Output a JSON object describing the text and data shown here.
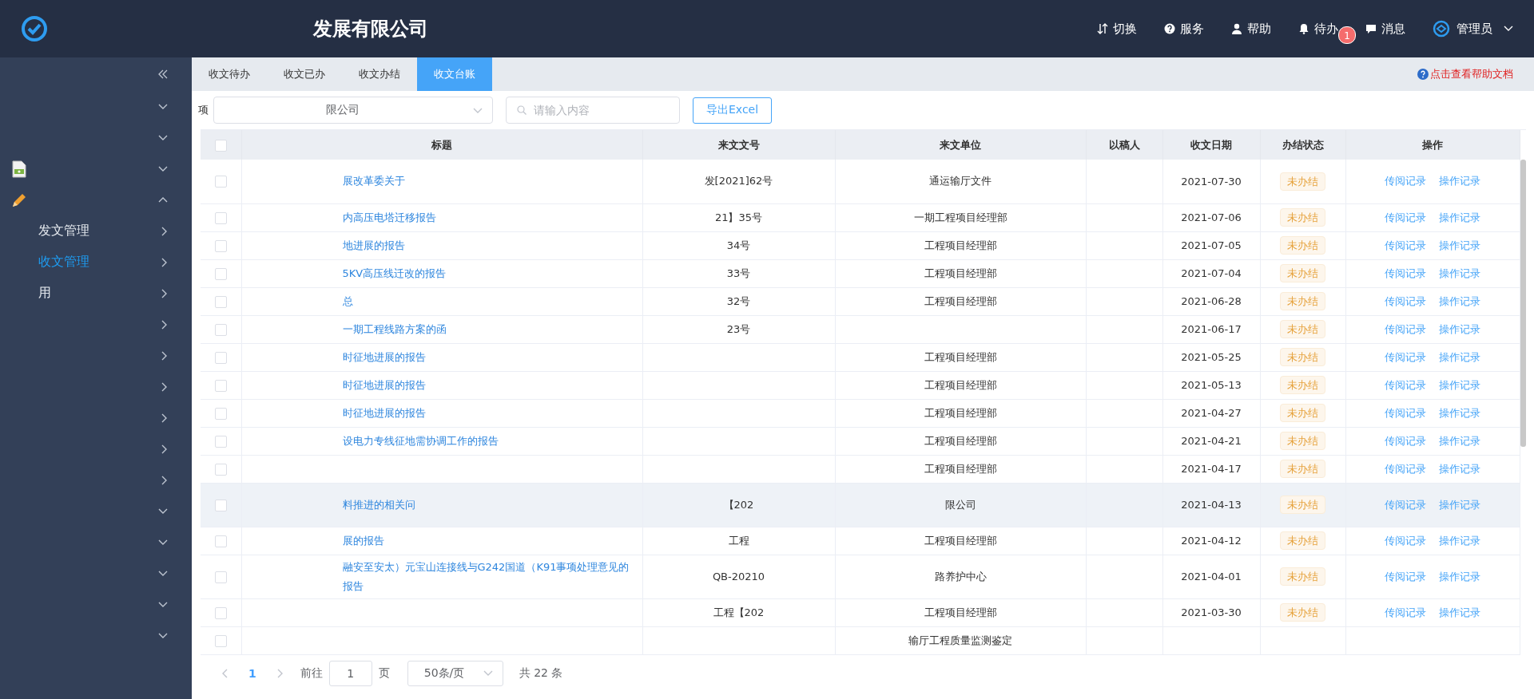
{
  "header": {
    "title": "发展有限公司",
    "actions": [
      {
        "kind": "switch",
        "label": "切换"
      },
      {
        "kind": "service",
        "label": "服务"
      },
      {
        "kind": "help",
        "label": "帮助"
      },
      {
        "kind": "todo",
        "label": "待办",
        "badge": "1"
      },
      {
        "kind": "message",
        "label": "消息"
      }
    ],
    "user": {
      "label": "管理员"
    }
  },
  "sidebar": {
    "items": [
      {
        "kind": "group",
        "expanded": false
      },
      {
        "kind": "group",
        "expanded": false
      },
      {
        "kind": "doc-group",
        "expanded": false
      },
      {
        "kind": "pencil-group",
        "expanded": true
      },
      {
        "kind": "sub",
        "label": "发文管理",
        "selected": false
      },
      {
        "kind": "sub",
        "label": "收文管理",
        "selected": true
      },
      {
        "kind": "sub",
        "label": "用",
        "selected": false
      },
      {
        "kind": "sub"
      },
      {
        "kind": "sub"
      },
      {
        "kind": "sub"
      },
      {
        "kind": "sub"
      },
      {
        "kind": "sub"
      },
      {
        "kind": "sub"
      },
      {
        "kind": "group",
        "expanded": false
      },
      {
        "kind": "group",
        "expanded": false
      },
      {
        "kind": "group",
        "expanded": false
      },
      {
        "kind": "group",
        "expanded": false
      },
      {
        "kind": "group",
        "expanded": false
      }
    ]
  },
  "tabs": [
    {
      "label": "收文待办",
      "selected": false
    },
    {
      "label": "收文已办",
      "selected": false
    },
    {
      "label": "收文办结",
      "selected": false
    },
    {
      "label": "收文台账",
      "selected": true
    }
  ],
  "help_link": "点击查看帮助文档",
  "filters": {
    "label": "项",
    "select_value": "限公司",
    "search": {
      "placeholder": "请输入内容"
    },
    "export_button": "导出Excel"
  },
  "table": {
    "all_selected": false,
    "columns": [
      "标题",
      "来文文号",
      "来文单位",
      "以稿人",
      "收文日期",
      "办结状态",
      "操作"
    ],
    "rows": [
      {
        "title": "展改革委关于",
        "doc_no": "发[2021]62号",
        "unit": "通运输厅文件",
        "date": "2021-07-30",
        "status": {
          "label": "未办结",
          "kind": "open"
        },
        "actions": [
          "传阅记录",
          "操作记录"
        ],
        "tall": true,
        "hovered": false
      },
      {
        "title": "内高压电塔迁移报告",
        "doc_no": "21】35号",
        "unit": "一期工程项目经理部",
        "date": "2021-07-06",
        "status": {
          "label": "未办结",
          "kind": "open"
        },
        "actions": [
          "传阅记录",
          "操作记录"
        ],
        "tall": false,
        "hovered": false
      },
      {
        "title": "地进展的报告",
        "doc_no": "34号",
        "unit": "工程项目经理部",
        "date": "2021-07-05",
        "status": {
          "label": "未办结",
          "kind": "open"
        },
        "actions": [
          "传阅记录",
          "操作记录"
        ],
        "tall": false,
        "hovered": false
      },
      {
        "title": "5KV高压线迁改的报告",
        "doc_no": "33号",
        "unit": "工程项目经理部",
        "date": "2021-07-04",
        "status": {
          "label": "未办结",
          "kind": "open"
        },
        "actions": [
          "传阅记录",
          "操作记录"
        ],
        "tall": false,
        "hovered": false
      },
      {
        "title": "总",
        "doc_no": "32号",
        "unit": "工程项目经理部",
        "date": "2021-06-28",
        "status": {
          "label": "未办结",
          "kind": "open"
        },
        "actions": [
          "传阅记录",
          "操作记录"
        ],
        "tall": false,
        "hovered": false
      },
      {
        "title": "一期工程线路方案的函",
        "doc_no": "23号",
        "date": "2021-06-17",
        "status": {
          "label": "未办结",
          "kind": "open"
        },
        "actions": [
          "传阅记录",
          "操作记录"
        ],
        "tall": false,
        "hovered": false
      },
      {
        "title": "时征地进展的报告",
        "unit": "工程项目经理部",
        "date": "2021-05-25",
        "status": {
          "label": "未办结",
          "kind": "open"
        },
        "actions": [
          "传阅记录",
          "操作记录"
        ],
        "tall": false,
        "hovered": false
      },
      {
        "title": "时征地进展的报告",
        "unit": "工程项目经理部",
        "date": "2021-05-13",
        "status": {
          "label": "未办结",
          "kind": "open"
        },
        "actions": [
          "传阅记录",
          "操作记录"
        ],
        "tall": false,
        "hovered": false
      },
      {
        "title": "时征地进展的报告",
        "unit": "工程项目经理部",
        "date": "2021-04-27",
        "status": {
          "label": "未办结",
          "kind": "open"
        },
        "actions": [
          "传阅记录",
          "操作记录"
        ],
        "tall": false,
        "hovered": false
      },
      {
        "title": "设电力专线征地需协调工作的报告",
        "unit": "工程项目经理部",
        "date": "2021-04-21",
        "status": {
          "label": "未办结",
          "kind": "open"
        },
        "actions": [
          "传阅记录",
          "操作记录"
        ],
        "tall": false,
        "hovered": false
      },
      {
        "unit": "工程项目经理部",
        "date": "2021-04-17",
        "status": {
          "label": "未办结",
          "kind": "open"
        },
        "actions": [
          "传阅记录",
          "操作记录"
        ],
        "tall": false,
        "hovered": false
      },
      {
        "title": "料推进的相关问",
        "doc_no": "【202",
        "unit": "限公司",
        "date": "2021-04-13",
        "status": {
          "label": "未办结",
          "kind": "open"
        },
        "actions": [
          "传阅记录",
          "操作记录"
        ],
        "tall": true,
        "hovered": true
      },
      {
        "title": "展的报告",
        "doc_no": "工程",
        "unit": "工程项目经理部",
        "date": "2021-04-12",
        "status": {
          "label": "未办结",
          "kind": "open"
        },
        "actions": [
          "传阅记录",
          "操作记录"
        ],
        "tall": false,
        "hovered": false
      },
      {
        "title": "融安至安太）元宝山连接线与G242国道（K91事项处理意见的报告",
        "doc_no": "QB-20210",
        "unit": "路养护中心",
        "date": "2021-04-01",
        "status": {
          "label": "未办结",
          "kind": "open"
        },
        "actions": [
          "传阅记录",
          "操作记录"
        ],
        "tall": true,
        "hovered": false
      },
      {
        "doc_no": "工程【202",
        "unit": "工程项目经理部",
        "date": "2021-03-30",
        "status": {
          "label": "未办结",
          "kind": "open"
        },
        "actions": [
          "传阅记录",
          "操作记录"
        ],
        "tall": false,
        "hovered": false
      },
      {
        "unit": "输厅工程质量监测鉴定",
        "tall": false,
        "hovered": false
      }
    ]
  },
  "pagination": {
    "current": "1",
    "goto_label": "前往",
    "goto_value": "1",
    "page_label": "页",
    "page_size": "50条/页",
    "total": "共 22 条"
  }
}
